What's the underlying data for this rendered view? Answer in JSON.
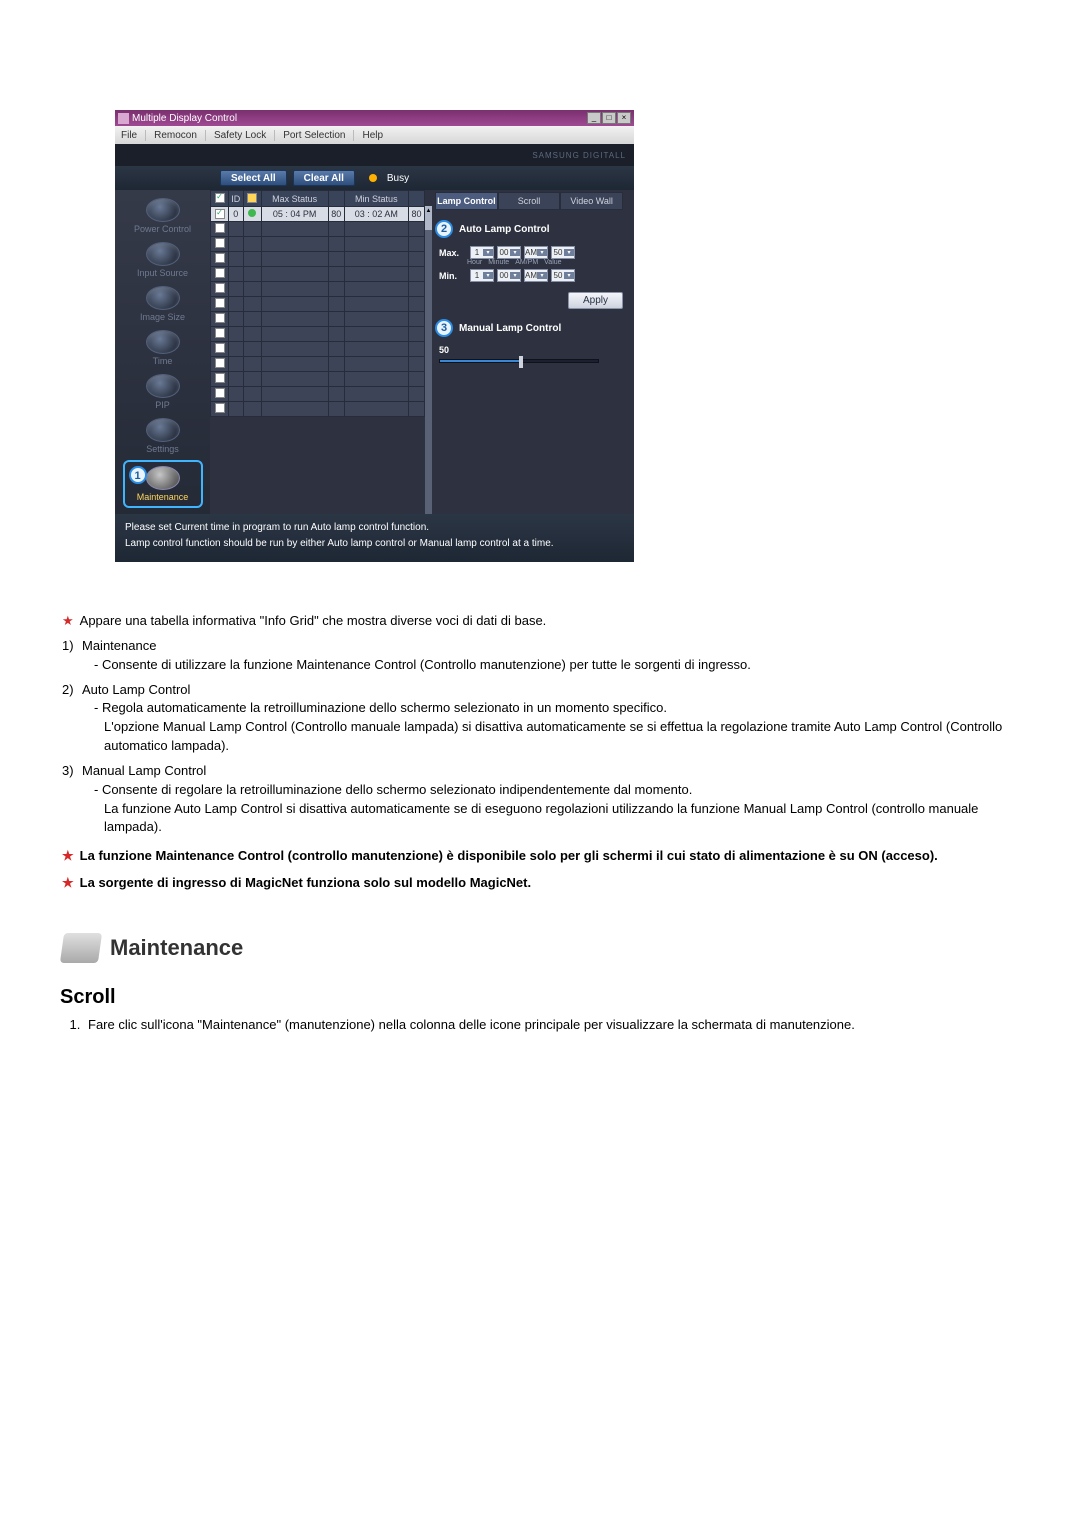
{
  "window": {
    "title": "Multiple Display Control",
    "menu": [
      "File",
      "Remocon",
      "Safety Lock",
      "Port Selection",
      "Help"
    ],
    "brand": "SAMSUNG DIGITALL"
  },
  "toolbar": {
    "select_all": "Select All",
    "clear_all": "Clear All",
    "busy": "Busy"
  },
  "sidebar": {
    "items": [
      {
        "label": "Power Control"
      },
      {
        "label": "Input Source"
      },
      {
        "label": "Image Size"
      },
      {
        "label": "Time"
      },
      {
        "label": "PIP"
      },
      {
        "label": "Settings"
      },
      {
        "label": "Maintenance"
      }
    ]
  },
  "grid": {
    "headers": [
      "",
      "ID",
      "",
      "Max Status",
      "",
      "Min Status",
      ""
    ],
    "row": {
      "id": "0",
      "max_status": "05 : 04 PM",
      "max_v": "80",
      "min_status": "03 : 02 AM",
      "min_v": "80"
    }
  },
  "rpanel": {
    "tabs": [
      "Lamp Control",
      "Scroll",
      "Video Wall"
    ],
    "auto_title": "Auto Lamp Control",
    "max_label": "Max.",
    "min_label": "Min.",
    "sel": {
      "hour": "1",
      "min": "00",
      "ampm": "AM",
      "val": "50"
    },
    "tiny": [
      "Hour",
      "Minute",
      "AM/PM",
      "Value"
    ],
    "apply": "Apply",
    "manual_title": "Manual Lamp Control",
    "manual_value": "50",
    "badge2": "2",
    "badge3": "3",
    "badge1": "1"
  },
  "footer": {
    "l1": "Please set Current time in program to run Auto lamp control function.",
    "l2": "Lamp control function should be run by either Auto lamp control or Manual lamp control at a time."
  },
  "doc": {
    "lead": "Appare una tabella informativa \"Info Grid\" che mostra diverse voci di dati di base.",
    "i1_n": "1)",
    "i1_t": "Maintenance",
    "i1_s": "- Consente di utilizzare la funzione Maintenance Control (Controllo manutenzione) per tutte le sorgenti di ingresso.",
    "i2_n": "2)",
    "i2_t": "Auto Lamp Control",
    "i2_s1": "- Regola automaticamente la retroilluminazione dello schermo selezionato in un momento specifico.",
    "i2_s2": "L'opzione Manual Lamp Control (Controllo manuale lampada) si disattiva automaticamente se si effettua la regolazione tramite Auto Lamp Control (Controllo automatico lampada).",
    "i3_n": "3)",
    "i3_t": "Manual Lamp Control",
    "i3_s1": "- Consente di regolare la retroilluminazione dello schermo selezionato indipendentemente dal momento.",
    "i3_s2": "La funzione Auto Lamp Control si disattiva automaticamente se di eseguono regolazioni utilizzando la funzione Manual Lamp Control (controllo manuale lampada).",
    "b1": "La funzione Maintenance Control (controllo manutenzione) è disponibile solo per gli schermi il cui stato di alimentazione è su ON (acceso).",
    "b2": "La sorgente di ingresso di MagicNet funziona solo sul modello MagicNet.",
    "sec_title": "Maintenance",
    "scroll": "Scroll",
    "ol1": "Fare clic sull'icona \"Maintenance\" (manutenzione) nella colonna delle icone principale per visualizzare la schermata di manutenzione."
  }
}
